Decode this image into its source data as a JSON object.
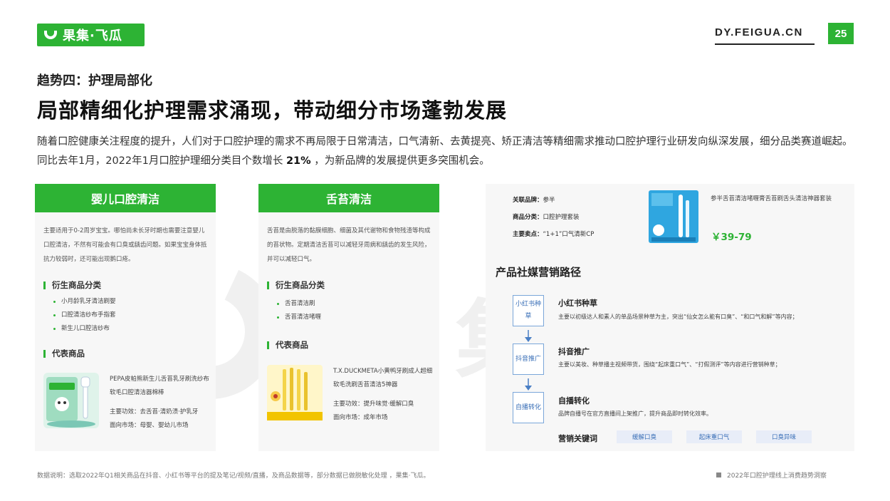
{
  "brand": {
    "logo_text": "果集·飞瓜",
    "site": "DY.FEIGUA.CN",
    "page_number": "25",
    "accent": "#2db334"
  },
  "watermark_text": "果集·飞瓜",
  "trend_label": "趋势四：护理局部化",
  "headline": "局部精细化护理需求涌现，带动细分市场蓬勃发展",
  "intro": {
    "before": "随着口腔健康关注程度的提升，人们对于口腔护理的需求不再局限于日常清洁，口气清新、去黄提亮、矫正清洁等精细需求推动口腔护理行业研发向纵深发展，细分品类赛道崛起。同比去年1月，2022年1月口腔护理细分类目个数增长 ",
    "highlight": "21%",
    "after": " ，为新品牌的发展提供更多突围机会。"
  },
  "cards": [
    {
      "title": "婴儿口腔清洁",
      "desc": "主要适用于0-2周岁宝宝。哪怕尚未长牙时期也需要注意婴儿口腔清洁，不然有可能会有口臭或龋齿问题。如果宝宝身体抵抗力较弱时，还可能出现鹅口疮。",
      "derived_title": "衍生商品分类",
      "derived": [
        "小月龄乳牙清洁刷婴",
        "口腔清洁纱布手指套",
        "新生儿口腔洁纱布"
      ],
      "rep_title": "代表商品",
      "product_name": "PEPA皮帕熊新生儿舌苔乳牙刷洗纱布软毛口腔清洁器棉棒",
      "product_effect": "主要功效：去舌苔·清奶渍·护乳牙",
      "product_market": "面向市场：母婴、婴幼儿市场"
    },
    {
      "title": "舌苔清洁",
      "desc": "舌苔是由脱落的黏膜细胞、细菌及其代谢物和食物残渣等构成的苔状物。定期清洁舌苔可以减轻牙周病和龋齿的发生风险，并可以减轻口气。",
      "derived_title": "衍生商品分类",
      "derived": [
        "舌苔清洁刷",
        "舌苔清洁啫喱"
      ],
      "rep_title": "代表商品",
      "product_name": "T.X.DUCKMETA小黄鸭牙刷成人超细软毛洗刷舌苔清洁5神器",
      "product_effect": "主要功效：提升味觉·缓解口臭",
      "product_market": "面向市场：成年市场"
    }
  ],
  "related": {
    "brand_key": "关联品牌：",
    "brand_val": "参半",
    "category_key": "商品分类：",
    "category_val": "口腔护理套装",
    "selling_key": "主要卖点：",
    "selling_val": "“1+1”口气清新CP",
    "product_name": "参半舌苔清洁啫喱膏舌苔刷舌头清洁神器套装",
    "price": "￥39-79"
  },
  "marketing": {
    "title": "产品社媒营销路径",
    "steps": [
      {
        "box": "小红书种草",
        "heading": "小红书种草",
        "desc": "主要以初级达人和素人的单品场景种草为主，突出“仙女怎么能有口臭”、“和口气和解”等内容；"
      },
      {
        "box": "抖音推广",
        "heading": "抖音推广",
        "desc": "主要以美妆、种草播主视频带货，围绕“起床重口气”、“打假测评”等内容进行营销种草；"
      },
      {
        "box": "自播转化",
        "heading": "自播转化",
        "desc": "品牌自播号在官方直播间上架推广，提升商品即时转化效率。"
      }
    ],
    "keywords_label": "营销关键词",
    "keywords": [
      "缓解口臭",
      "起床重口气",
      "口臭异味"
    ]
  },
  "footer": {
    "note": "数据说明：选取2022年Q1相关商品在抖音、小红书等平台的提及笔记/视频/直播，及商品数据等，部分数据已做脱敏化处理 ，果集·飞瓜。",
    "report": "2022年口腔护理线上消费趋势洞察"
  }
}
